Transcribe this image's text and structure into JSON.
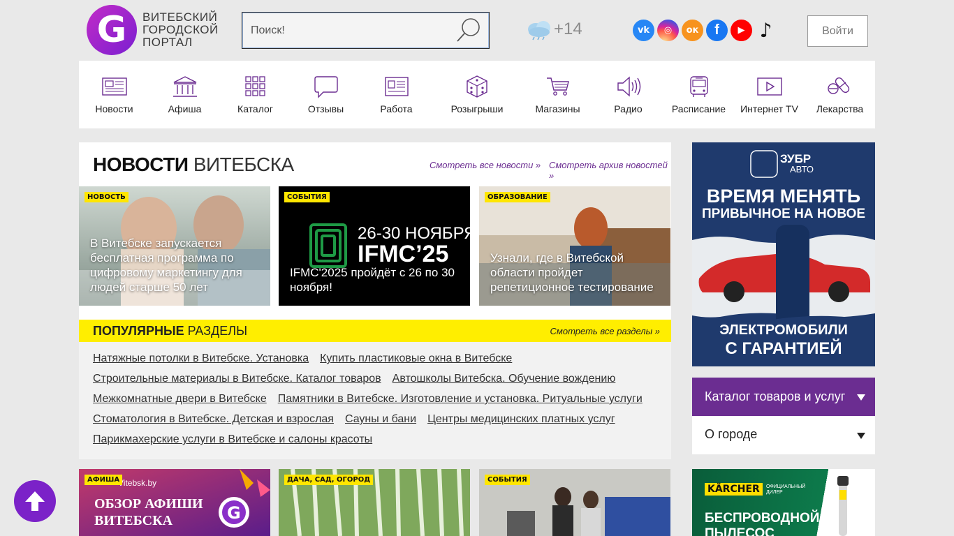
{
  "header": {
    "logo_letter": "G",
    "logo_text_1": "ВИТЕБСКИЙ",
    "logo_text_2": "ГОРОДСКОЙ",
    "logo_text_3": "ПОРТАЛ",
    "search_placeholder": "Поиск!",
    "weather_temp": "+14",
    "login_label": "Войти",
    "socials": [
      {
        "name": "vk-icon",
        "glyph": "vk"
      },
      {
        "name": "instagram-icon",
        "glyph": "◎"
      },
      {
        "name": "odnoklassniki-icon",
        "glyph": "ок"
      },
      {
        "name": "facebook-icon",
        "glyph": "f"
      },
      {
        "name": "youtube-icon",
        "glyph": "▶"
      },
      {
        "name": "tiktok-icon",
        "glyph": "♪"
      }
    ]
  },
  "nav": [
    {
      "label": "Новости",
      "icon": "newspaper-icon"
    },
    {
      "label": "Афиша",
      "icon": "theatre-icon"
    },
    {
      "label": "Каталог",
      "icon": "grid-icon"
    },
    {
      "label": "Отзывы",
      "icon": "chat-bubble-icon"
    },
    {
      "label": "Работа",
      "icon": "resume-icon"
    },
    {
      "label": "Розыгрыши",
      "icon": "dice-icon"
    },
    {
      "label": "Магазины",
      "icon": "cart-icon"
    },
    {
      "label": "Радио",
      "icon": "speaker-icon"
    },
    {
      "label": "Расписание",
      "icon": "bus-icon"
    },
    {
      "label": "Интернет TV",
      "icon": "play-icon"
    },
    {
      "label": "Лекарства",
      "icon": "pills-icon"
    }
  ],
  "news": {
    "title_bold": "НОВОСТИ",
    "title_rest": " ВИТЕБСКА",
    "link_all": "Смотреть все новости »",
    "link_archive": "Смотреть архив новостей »",
    "cards": [
      {
        "tag": "НОВОСТЬ",
        "title": "В Витебске запускается бесплатная программа по цифровому маркетингу для людей старше 50 лет"
      },
      {
        "tag": "СОБЫТИЯ",
        "title": "IFMC'2025 пройдёт с 26 по 30 ноября!",
        "banner_dates": "26-30 НОЯБРЯ",
        "banner_name": "IFMC'25"
      },
      {
        "tag": "ОБРАЗОВАНИЕ",
        "title": "Узнали, где в Витебской области пройдет репетиционное тестирование"
      }
    ]
  },
  "popular": {
    "title_bold": "ПОПУЛЯРНЫЕ",
    "title_rest": " РАЗДЕЛЫ",
    "link_all": "Смотреть все разделы »",
    "rows": [
      [
        "Натяжные потолки в Витебске. Установка",
        "Купить пластиковые окна в Витебске"
      ],
      [
        "Строительные материалы в Витебске. Каталог товаров",
        "Автошколы Витебска. Обучение вождению"
      ],
      [
        "Межкомнатные двери в Витебске",
        "Памятники в Витебске. Изготовление и установка. Ритуальные услуги"
      ],
      [
        "Стоматология в Витебске. Детская и взрослая",
        "Сауны и бани",
        "Центры медицинских платных услуг"
      ],
      [
        "Парикмахерские услуги в Витебске и салоны красоты"
      ]
    ]
  },
  "bottom_cards": [
    {
      "tag": "АФИША",
      "site": "Vitebsk.by",
      "title": "ОБЗОР АФИШИ ВИТЕБСКА"
    },
    {
      "tag": "ДАЧА, САД, ОГОРОД"
    },
    {
      "tag": "СОБЫТИЯ"
    }
  ],
  "sidebar": {
    "ad1": {
      "brand_1": "ЗУБР",
      "brand_2": "АВТО",
      "headline_1": "ВРЕМЯ МЕНЯТЬ",
      "headline_2": "ПРИВЫЧНОЕ НА НОВОЕ",
      "footer_1": "ЭЛЕКТРОМОБИЛИ",
      "footer_2": "С ГАРАНТИЕЙ"
    },
    "catalog_label": "Каталог товаров и услуг",
    "city_label": "О городе",
    "ad2": {
      "brand": "KÄRCHER",
      "dealer": "ОФИЦИАЛЬНЫЙ ДИЛЕР",
      "headline_1": "БЕСПРОВОДНОЙ",
      "headline_2": "ПЫЛЕСОС"
    }
  },
  "colors": {
    "accent_purple": "#6b2d91",
    "tag_yellow": "#ffe600",
    "popular_bar": "#ffee00"
  }
}
